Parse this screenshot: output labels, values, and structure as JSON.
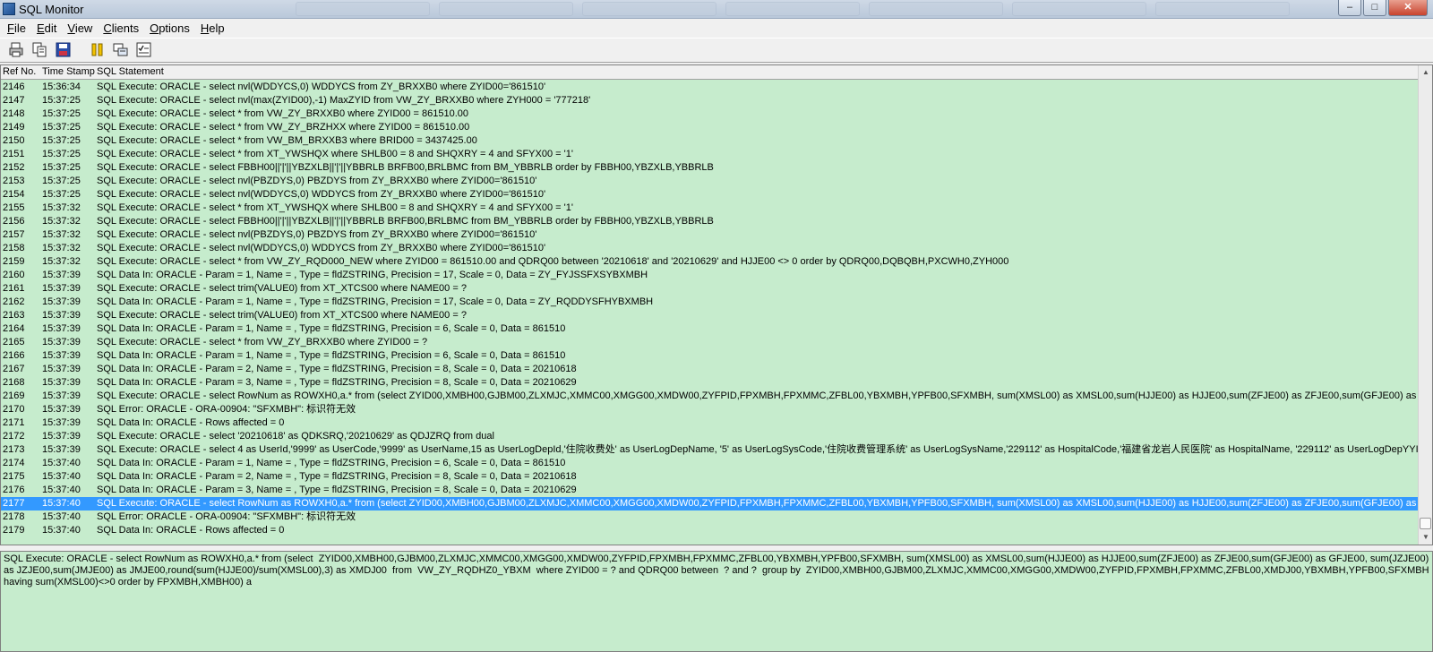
{
  "window": {
    "title": "SQL Monitor"
  },
  "menu": [
    "File",
    "Edit",
    "View",
    "Clients",
    "Options",
    "Help"
  ],
  "toolbar": {
    "buttons": [
      "print-icon",
      "copy-icon",
      "save-icon",
      "pause-icon",
      "clients-icon",
      "options-icon"
    ]
  },
  "grid": {
    "headers": {
      "ref": "Ref No.",
      "time": "Time Stamp",
      "sql": "SQL Statement"
    },
    "selected_ref": "2177",
    "rows": [
      {
        "ref": "2146",
        "time": "15:36:34",
        "sql": "SQL Execute: ORACLE - select nvl(WDDYCS,0) WDDYCS from ZY_BRXXB0 where ZYID00='861510'"
      },
      {
        "ref": "2147",
        "time": "15:37:25",
        "sql": "SQL Execute: ORACLE - select nvl(max(ZYID00),-1) MaxZYID from VW_ZY_BRXXB0 where ZYH000 = '777218'"
      },
      {
        "ref": "2148",
        "time": "15:37:25",
        "sql": "SQL Execute: ORACLE - select * from VW_ZY_BRXXB0 where ZYID00 = 861510.00"
      },
      {
        "ref": "2149",
        "time": "15:37:25",
        "sql": "SQL Execute: ORACLE - select * from VW_ZY_BRZHXX where ZYID00 = 861510.00"
      },
      {
        "ref": "2150",
        "time": "15:37:25",
        "sql": "SQL Execute: ORACLE - select * from VW_BM_BRXXB3 where BRID00 = 3437425.00"
      },
      {
        "ref": "2151",
        "time": "15:37:25",
        "sql": "SQL Execute: ORACLE - select * from XT_YWSHQX where SHLB00 = 8 and SHQXRY = 4 and SFYX00 = '1'"
      },
      {
        "ref": "2152",
        "time": "15:37:25",
        "sql": "SQL Execute: ORACLE - select FBBH00||'|'||YBZXLB||'|'||YBBRLB BRFB00,BRLBMC from BM_YBBRLB order by FBBH00,YBZXLB,YBBRLB"
      },
      {
        "ref": "2153",
        "time": "15:37:25",
        "sql": "SQL Execute: ORACLE - select nvl(PBZDYS,0) PBZDYS from ZY_BRXXB0 where ZYID00='861510'"
      },
      {
        "ref": "2154",
        "time": "15:37:25",
        "sql": "SQL Execute: ORACLE - select nvl(WDDYCS,0) WDDYCS from ZY_BRXXB0 where ZYID00='861510'"
      },
      {
        "ref": "2155",
        "time": "15:37:32",
        "sql": "SQL Execute: ORACLE - select * from XT_YWSHQX where SHLB00 = 8 and SHQXRY = 4 and SFYX00 = '1'"
      },
      {
        "ref": "2156",
        "time": "15:37:32",
        "sql": "SQL Execute: ORACLE - select FBBH00||'|'||YBZXLB||'|'||YBBRLB BRFB00,BRLBMC from BM_YBBRLB order by FBBH00,YBZXLB,YBBRLB"
      },
      {
        "ref": "2157",
        "time": "15:37:32",
        "sql": "SQL Execute: ORACLE - select nvl(PBZDYS,0) PBZDYS from ZY_BRXXB0 where ZYID00='861510'"
      },
      {
        "ref": "2158",
        "time": "15:37:32",
        "sql": "SQL Execute: ORACLE - select nvl(WDDYCS,0) WDDYCS from ZY_BRXXB0 where ZYID00='861510'"
      },
      {
        "ref": "2159",
        "time": "15:37:32",
        "sql": "SQL Execute: ORACLE - select * from VW_ZY_RQD000_NEW where ZYID00 = 861510.00 and QDRQ00 between  '20210618' and '20210629'   and HJJE00 <> 0  order by QDRQ00,DQBQBH,PXCWH0,ZYH000"
      },
      {
        "ref": "2160",
        "time": "15:37:39",
        "sql": "SQL Data In: ORACLE - Param = 1, Name = , Type = fldZSTRING, Precision = 17, Scale = 0, Data = ZY_FYJSSFXSYBXMBH"
      },
      {
        "ref": "2161",
        "time": "15:37:39",
        "sql": "SQL Execute: ORACLE - select trim(VALUE0) from XT_XTCS00 where NAME00 = ?"
      },
      {
        "ref": "2162",
        "time": "15:37:39",
        "sql": "SQL Data In: ORACLE - Param = 1, Name = , Type = fldZSTRING, Precision = 17, Scale = 0, Data = ZY_RQDDYSFHYBXMBH"
      },
      {
        "ref": "2163",
        "time": "15:37:39",
        "sql": "SQL Execute: ORACLE - select trim(VALUE0) from XT_XTCS00 where NAME00 = ?"
      },
      {
        "ref": "2164",
        "time": "15:37:39",
        "sql": "SQL Data In: ORACLE - Param = 1, Name = , Type = fldZSTRING, Precision = 6, Scale = 0, Data = 861510"
      },
      {
        "ref": "2165",
        "time": "15:37:39",
        "sql": "SQL Execute: ORACLE - select * from VW_ZY_BRXXB0 where ZYID00 = ?"
      },
      {
        "ref": "2166",
        "time": "15:37:39",
        "sql": "SQL Data In: ORACLE - Param = 1, Name = , Type = fldZSTRING, Precision = 6, Scale = 0, Data = 861510"
      },
      {
        "ref": "2167",
        "time": "15:37:39",
        "sql": "SQL Data In: ORACLE - Param = 2, Name = , Type = fldZSTRING, Precision = 8, Scale = 0, Data = 20210618"
      },
      {
        "ref": "2168",
        "time": "15:37:39",
        "sql": "SQL Data In: ORACLE - Param = 3, Name = , Type = fldZSTRING, Precision = 8, Scale = 0, Data = 20210629"
      },
      {
        "ref": "2169",
        "time": "15:37:39",
        "sql": "SQL Execute: ORACLE - select RowNum as ROWXH0,a.* from (select  ZYID00,XMBH00,GJBM00,ZLXMJC,XMMC00,XMGG00,XMDW00,ZYFPID,FPXMBH,FPXMMC,ZFBL00,YBXMBH,YPFB00,SFXMBH, sum(XMSL00) as XMSL00,sum(HJJE00) as HJJE00,sum(ZFJE00) as ZFJE00,sum(GFJE00) as GFJE00, su"
      },
      {
        "ref": "2170",
        "time": "15:37:39",
        "sql": "SQL Error: ORACLE - ORA-00904: \"SFXMBH\": 标识符无效"
      },
      {
        "ref": "2171",
        "time": "15:37:39",
        "sql": "SQL Data In: ORACLE - Rows affected = 0"
      },
      {
        "ref": "2172",
        "time": "15:37:39",
        "sql": "SQL Execute: ORACLE - select '20210618' as QDKSRQ,'20210629' as QDJZRQ from dual"
      },
      {
        "ref": "2173",
        "time": "15:37:39",
        "sql": "SQL Execute: ORACLE - select 4 as UserId,'9999' as UserCode,'9999' as UserName,15 as UserLogDepId,'住院收费处' as UserLogDepName, '5' as UserLogSysCode,'住院收费管理系统' as UserLogSysName,'229112' as HospitalCode,'福建省龙岩人民医院' as HospitalName, '229112' as UserLogDepYYID,'福"
      },
      {
        "ref": "2174",
        "time": "15:37:40",
        "sql": "SQL Data In: ORACLE - Param = 1, Name = , Type = fldZSTRING, Precision = 6, Scale = 0, Data = 861510"
      },
      {
        "ref": "2175",
        "time": "15:37:40",
        "sql": "SQL Data In: ORACLE - Param = 2, Name = , Type = fldZSTRING, Precision = 8, Scale = 0, Data = 20210618"
      },
      {
        "ref": "2176",
        "time": "15:37:40",
        "sql": "SQL Data In: ORACLE - Param = 3, Name = , Type = fldZSTRING, Precision = 8, Scale = 0, Data = 20210629"
      },
      {
        "ref": "2177",
        "time": "15:37:40",
        "sql": "SQL Execute: ORACLE - select RowNum as ROWXH0,a.* from (select  ZYID00,XMBH00,GJBM00,ZLXMJC,XMMC00,XMGG00,XMDW00,ZYFPID,FPXMBH,FPXMMC,ZFBL00,YBXMBH,YPFB00,SFXMBH, sum(XMSL00) as XMSL00,sum(HJJE00) as HJJE00,sum(ZFJE00) as ZFJE00,sum(GFJE00) as GFJE00, su"
      },
      {
        "ref": "2178",
        "time": "15:37:40",
        "sql": "SQL Error: ORACLE - ORA-00904: \"SFXMBH\": 标识符无效"
      },
      {
        "ref": "2179",
        "time": "15:37:40",
        "sql": "SQL Data In: ORACLE - Rows affected = 0"
      }
    ]
  },
  "detail": {
    "text": "SQL Execute: ORACLE - select RowNum as ROWXH0,a.* from (select  ZYID00,XMBH00,GJBM00,ZLXMJC,XMMC00,XMGG00,XMDW00,ZYFPID,FPXMBH,FPXMMC,ZFBL00,YBXMBH,YPFB00,SFXMBH, sum(XMSL00) as XMSL00,sum(HJJE00) as HJJE00,sum(ZFJE00) as ZFJE00,sum(GFJE00) as GFJE00, sum(JZJE00) as JZJE00,sum(JMJE00) as JMJE00,round(sum(HJJE00)/sum(XMSL00),3) as XMDJ00  from  VW_ZY_RQDHZ0_YBXM  where ZYID00 = ? and QDRQ00 between  ? and ?  group by  ZYID00,XMBH00,GJBM00,ZLXMJC,XMMC00,XMGG00,XMDW00,ZYFPID,FPXMBH,FPXMMC,ZFBL00,XMDJ00,YBXMBH,YPFB00,SFXMBH  having sum(XMSL00)<>0 order by FPXMBH,XMBH00) a"
  },
  "colors": {
    "grid_bg": "#c6eccd",
    "selection": "#3399ff"
  }
}
